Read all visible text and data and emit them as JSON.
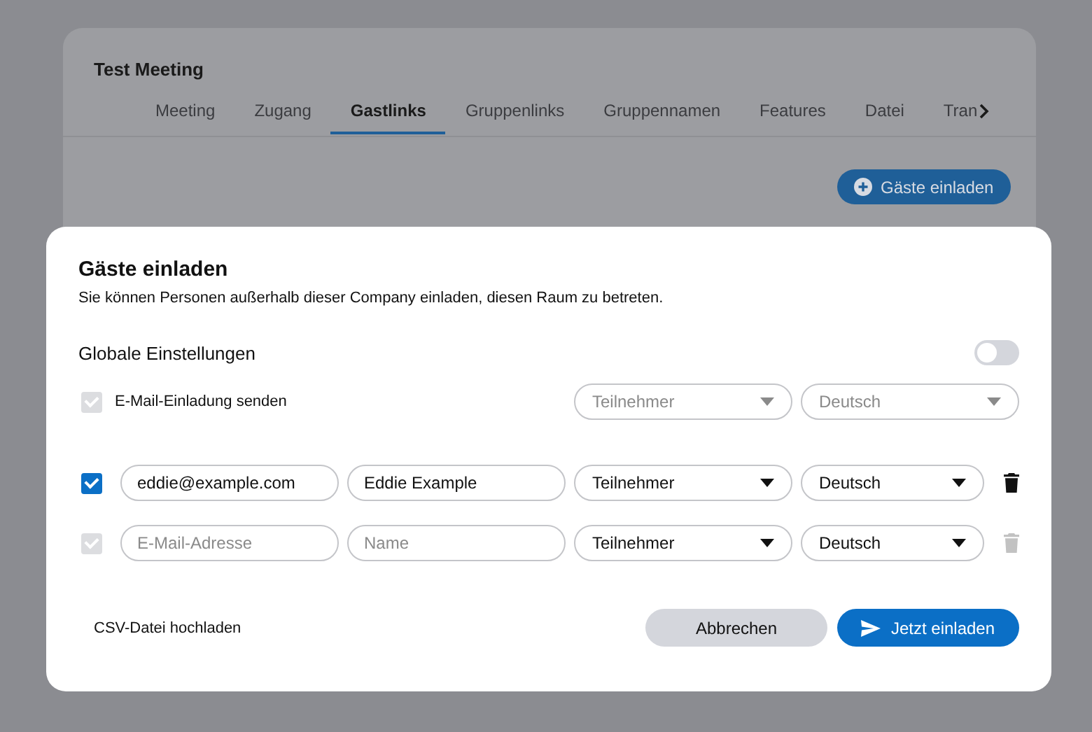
{
  "background": {
    "title": "Test Meeting",
    "tabs": [
      {
        "label": "Meeting",
        "selected": false
      },
      {
        "label": "Zugang",
        "selected": false
      },
      {
        "label": "Gastlinks",
        "selected": true
      },
      {
        "label": "Gruppenlinks",
        "selected": false
      },
      {
        "label": "Gruppennamen",
        "selected": false
      },
      {
        "label": "Features",
        "selected": false
      },
      {
        "label": "Datei",
        "selected": false
      },
      {
        "label": "Tran",
        "selected": false
      }
    ],
    "invite_button": "Gäste einladen"
  },
  "dialog": {
    "title": "Gäste einladen",
    "description": "Sie können Personen außerhalb dieser Company einladen, diesen Raum zu betreten.",
    "global_settings": {
      "label": "Globale Einstellungen",
      "on": false
    },
    "email_invite": {
      "label": "E-Mail-Einladung senden",
      "checked": true,
      "disabled": true,
      "role": "Teilnehmer",
      "language": "Deutsch"
    },
    "guests": [
      {
        "checked": true,
        "disabled": false,
        "email": {
          "value": "eddie@example.com"
        },
        "name": {
          "value": "Eddie Example"
        },
        "role": "Teilnehmer",
        "language": "Deutsch"
      },
      {
        "checked": true,
        "disabled": true,
        "email": {
          "placeholder": "E-Mail-Adresse"
        },
        "name": {
          "placeholder": "Name"
        },
        "role": "Teilnehmer",
        "language": "Deutsch"
      }
    ],
    "csv_link": "CSV-Datei hochladen",
    "cancel_button": "Abbrechen",
    "submit_button": "Jetzt einladen"
  }
}
